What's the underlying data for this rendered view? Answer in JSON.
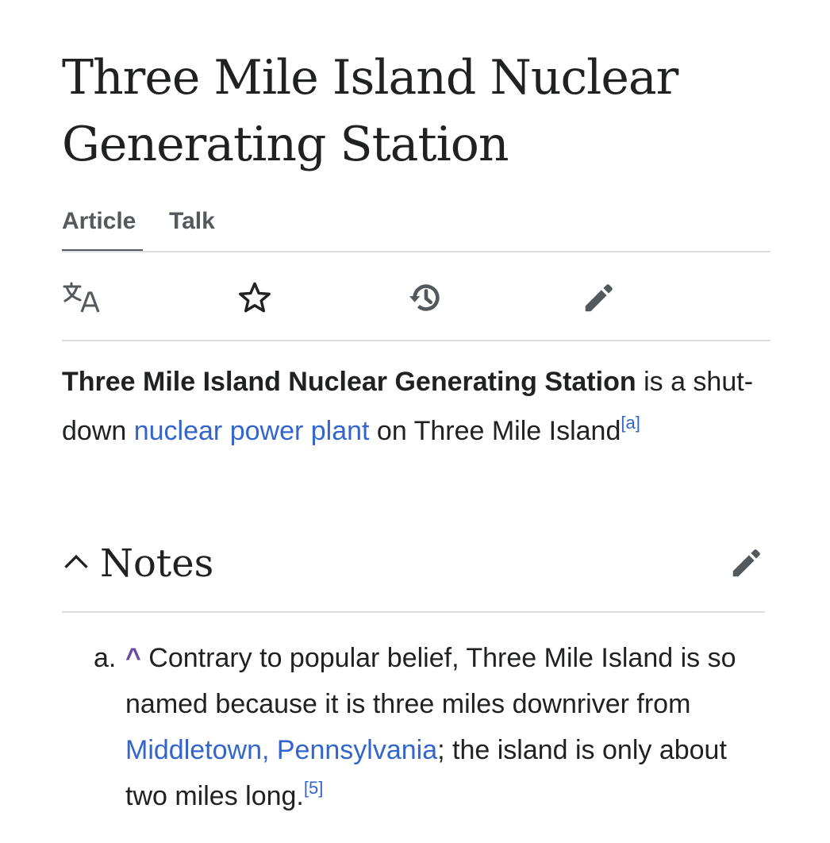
{
  "page": {
    "title": "Three Mile Island Nuclear Generating Station"
  },
  "tabs": {
    "article": "Article",
    "talk": "Talk"
  },
  "toolbar": {
    "language_icon": "language-icon",
    "watch_icon": "star-icon",
    "history_icon": "history-icon",
    "edit_icon": "pencil-icon"
  },
  "lead": {
    "bold_subject": "Three Mile Island Nuclear Generating Station",
    "text_1": " is a shut-down ",
    "link_text": "nuclear power plant",
    "text_2": " on Three Mile Island",
    "footnote": "[a]"
  },
  "notes_section": {
    "chevron_icon": "chevron-up-icon",
    "title": "Notes",
    "edit_icon": "pencil-icon",
    "items": [
      {
        "marker": "a.",
        "caret": "^",
        "text_1": " Contrary to popular belief, Three Mile Island is so named because it is three miles downriver from ",
        "link_text": "Middletown, Pennsylvania",
        "text_2": "; the island is only about two miles long.",
        "ref": "[5]"
      }
    ]
  },
  "colors": {
    "link": "#3366cc",
    "text": "#202122",
    "tab_active": "#54595d",
    "divider": "#dadde3",
    "caret": "#6b4ba1"
  }
}
